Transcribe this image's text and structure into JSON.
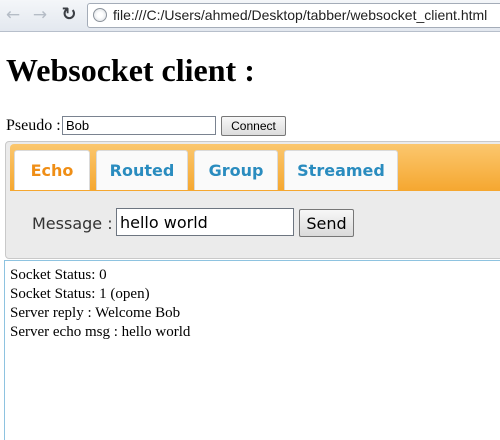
{
  "browser": {
    "url": "file:///C:/Users/ahmed/Desktop/tabber/websocket_client.html",
    "back_icon": "back-arrow-icon",
    "forward_icon": "forward-arrow-icon",
    "reload_icon": "reload-icon",
    "page_icon": "page-globe-icon"
  },
  "page": {
    "title": "Websocket client :"
  },
  "pseudo": {
    "label": "Pseudo :",
    "value": "Bob",
    "connect_label": "Connect"
  },
  "tabs": [
    {
      "label": "Echo",
      "active": true
    },
    {
      "label": "Routed",
      "active": false
    },
    {
      "label": "Group",
      "active": false
    },
    {
      "label": "Streamed",
      "active": false
    }
  ],
  "message": {
    "label": "Message :",
    "value": "hello world",
    "send_label": "Send"
  },
  "log": {
    "lines": [
      "Socket Status: 0",
      "Socket Status: 1 (open)",
      "Server reply : Welcome Bob",
      "Server echo msg : hello world"
    ]
  },
  "colors": {
    "tab_bar": "#f5a730",
    "active_tab_text": "#ef8e16",
    "tab_text": "#2a8cbf",
    "log_border": "#8ec3e0"
  }
}
